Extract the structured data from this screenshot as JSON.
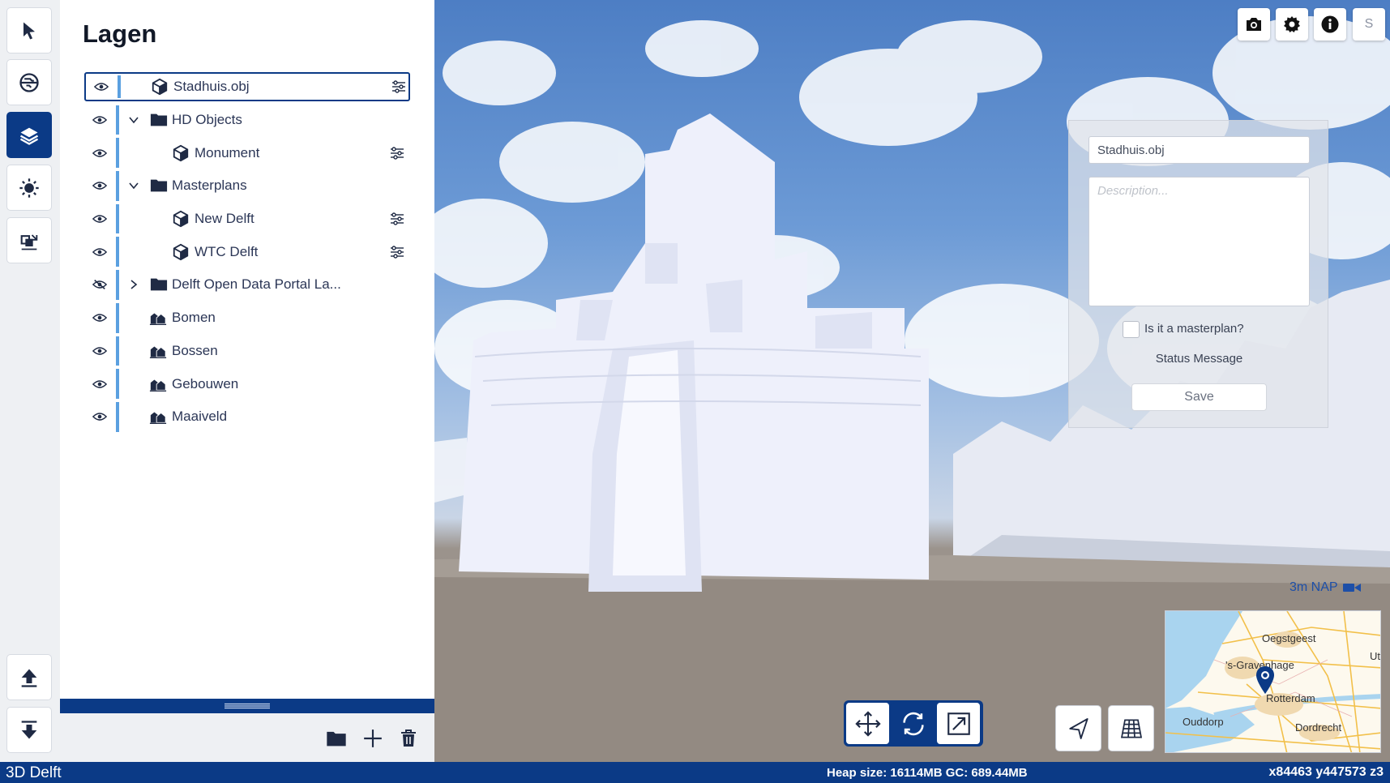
{
  "colors": {
    "primary": "#0b3a86",
    "accent_bar": "#5ba0e0",
    "status_bar": "#0b3a86"
  },
  "tool_rail": {
    "top_items": [
      {
        "icon": "pointer-icon"
      },
      {
        "icon": "section-plane-icon"
      },
      {
        "icon": "layers-icon",
        "active": true
      },
      {
        "icon": "sun-icon"
      },
      {
        "icon": "data-import-icon"
      }
    ],
    "bottom_items": [
      {
        "icon": "upload-icon"
      },
      {
        "icon": "download-icon"
      }
    ]
  },
  "layer_panel": {
    "title": "Lagen",
    "layers": [
      {
        "label": "Stadhuis.obj",
        "icon": "cube-icon",
        "depth": 1,
        "visible": true,
        "selected": true,
        "has_settings": true
      },
      {
        "label": "HD Objects",
        "icon": "folder-icon",
        "depth": 1,
        "visible": true,
        "expandable": "open"
      },
      {
        "label": "Monument",
        "icon": "cube-icon",
        "depth": 2,
        "visible": true,
        "has_settings": true
      },
      {
        "label": "Masterplans",
        "icon": "folder-icon",
        "depth": 1,
        "visible": true,
        "expandable": "open"
      },
      {
        "label": "New Delft",
        "icon": "cube-icon",
        "depth": 2,
        "visible": true,
        "has_settings": true
      },
      {
        "label": "WTC Delft",
        "icon": "cube-icon",
        "depth": 2,
        "visible": true,
        "has_settings": true
      },
      {
        "label": "Delft Open Data Portal La...",
        "icon": "folder-icon",
        "depth": 1,
        "visible": false,
        "expandable": "closed"
      },
      {
        "label": "Bomen",
        "icon": "buildings-icon",
        "depth": 1,
        "visible": true
      },
      {
        "label": "Bossen",
        "icon": "buildings-icon",
        "depth": 1,
        "visible": true
      },
      {
        "label": "Gebouwen",
        "icon": "buildings-icon",
        "depth": 1,
        "visible": true
      },
      {
        "label": "Maaiveld",
        "icon": "buildings-icon",
        "depth": 1,
        "visible": true
      }
    ],
    "actions": [
      {
        "icon": "folder-icon"
      },
      {
        "icon": "plus-icon"
      },
      {
        "icon": "trash-icon"
      }
    ]
  },
  "viewport": {
    "top_buttons": [
      {
        "icon": "camera-icon"
      },
      {
        "icon": "gear-icon"
      },
      {
        "icon": "info-icon"
      },
      {
        "label": "S"
      }
    ],
    "dialog": {
      "name_value": "Stadhuis.obj",
      "description_placeholder": "Description...",
      "masterplan_label": "Is it a masterplan?",
      "masterplan_checked": false,
      "status_message": "Status Message",
      "save_label": "Save"
    },
    "camera_height": "3m NAP",
    "minimap_labels": {
      "oegstgeest": "Oegstgeest",
      "gravenhage": "'s-Gravenhage",
      "rotterdam": "Rotterdam",
      "dordrecht": "Dordrecht",
      "ouddorp": "Ouddorp",
      "ut": "Ut"
    },
    "gizmo": [
      {
        "icon": "move-icon"
      },
      {
        "icon": "rotate-icon",
        "active": true
      },
      {
        "icon": "scale-icon"
      }
    ],
    "nav_buttons": [
      {
        "icon": "compass-arrow-icon"
      },
      {
        "icon": "grid-perspective-icon"
      }
    ]
  },
  "status_bar": {
    "app_name": "3D Delft",
    "heap": "Heap size: 16114MB GC: 689.44MB",
    "coordinates": "x84463 y447573 z3"
  }
}
